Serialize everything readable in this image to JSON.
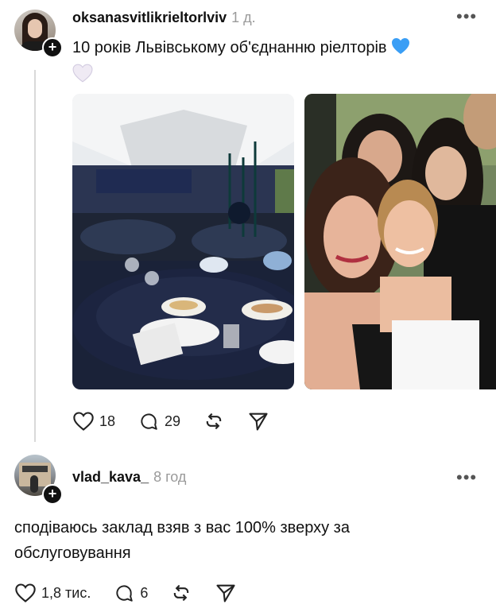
{
  "post": {
    "username": "oksanasvitlikrieltorlviv",
    "time": "1 д.",
    "text": "10 років Львівському об'єднанню ріелторів",
    "emoji_1": "blue-heart-icon",
    "emoji_2": "white-heart-icon",
    "stats": {
      "likes": "18",
      "comments": "29"
    }
  },
  "reply": {
    "username": "vlad_kava_",
    "time": "8 год",
    "text": "сподіваюсь заклад взяв з вас 100% зверху за обслуговування",
    "stats": {
      "likes": "1,8 тис.",
      "comments": "6"
    }
  },
  "colors": {
    "accent_blue": "#3a9ef5",
    "muted": "#9a9a9a",
    "line": "#d9d9d9"
  }
}
